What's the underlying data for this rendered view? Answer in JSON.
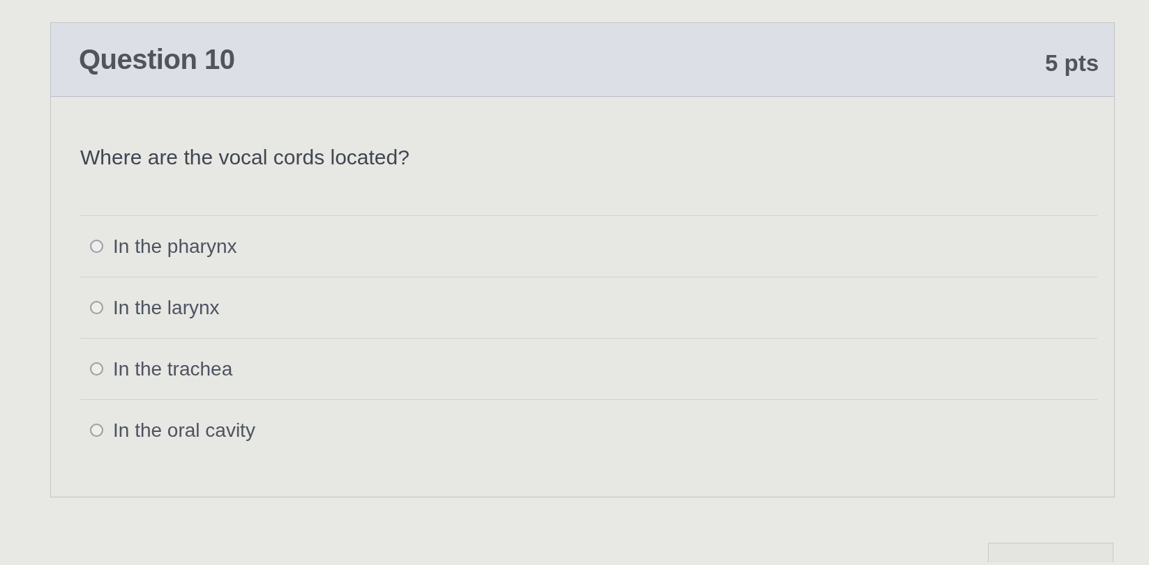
{
  "question": {
    "title": "Question 10",
    "points": "5 pts",
    "text": "Where are the vocal cords located?"
  },
  "answers": [
    {
      "label": "In the pharynx",
      "selected": false
    },
    {
      "label": "In the larynx",
      "selected": false
    },
    {
      "label": "In the trachea",
      "selected": false
    },
    {
      "label": "In the oral cavity",
      "selected": false
    }
  ]
}
